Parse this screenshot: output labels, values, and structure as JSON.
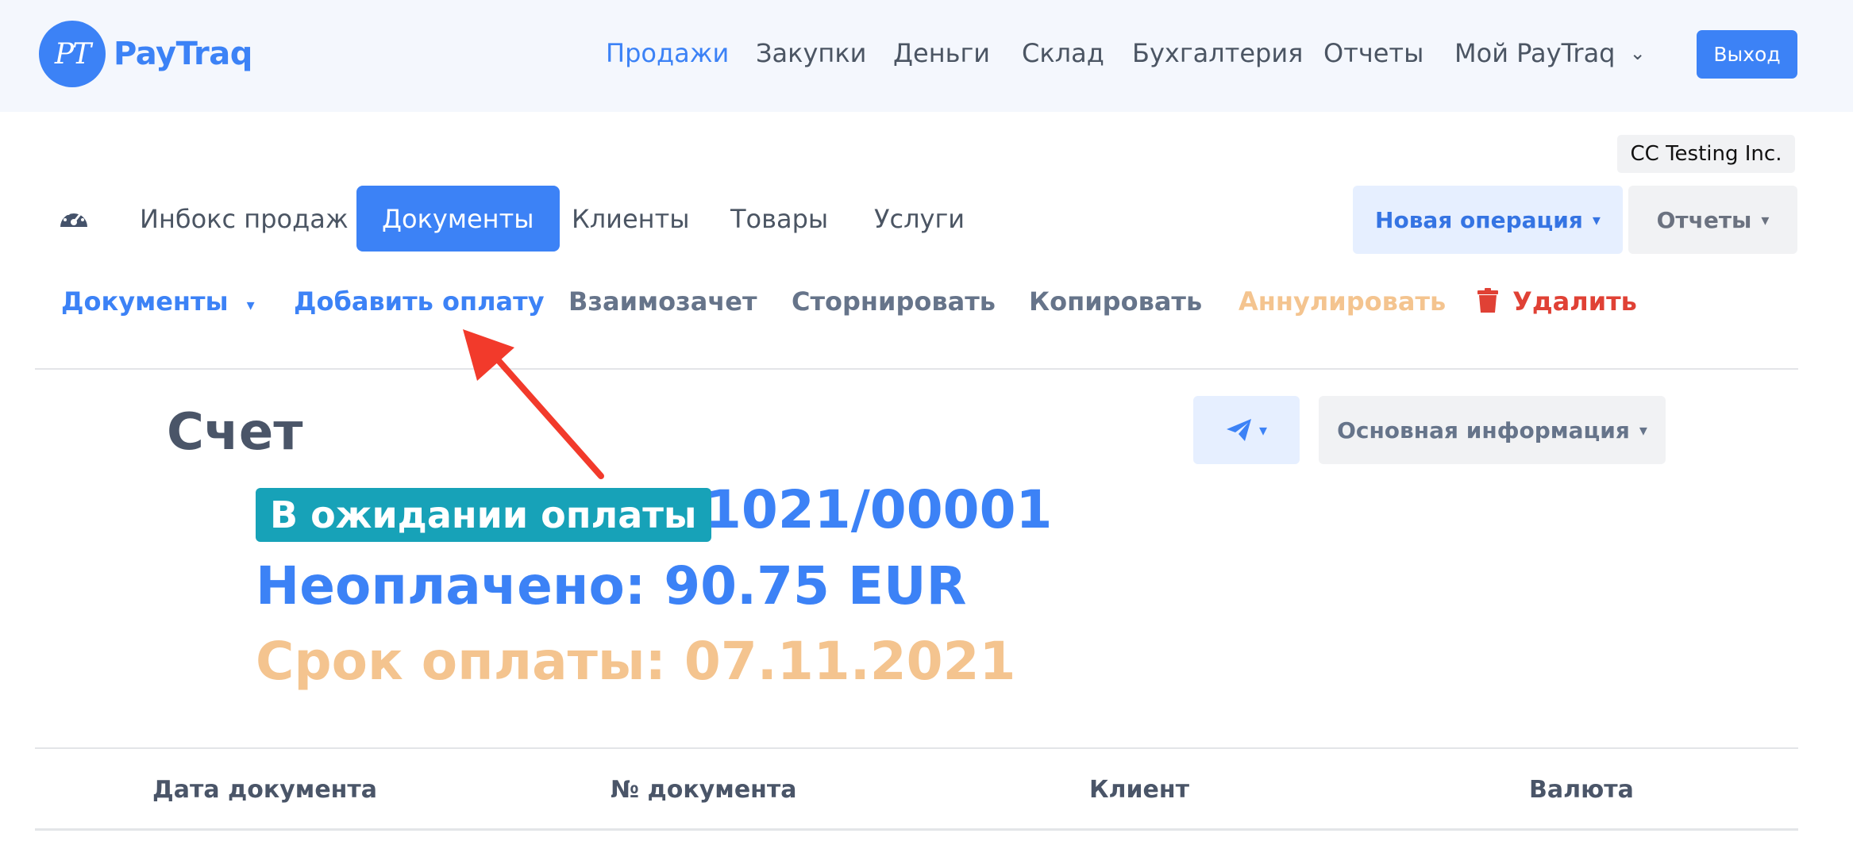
{
  "brand": {
    "logo_mark": "PT",
    "name": "PayTraq",
    "accent": "#3c82f6"
  },
  "topnav": {
    "items": [
      {
        "label": "Продажи",
        "active": true
      },
      {
        "label": "Закупки"
      },
      {
        "label": "Деньги"
      },
      {
        "label": "Склад"
      },
      {
        "label": "Бухгалтерия"
      },
      {
        "label": "Отчеты"
      },
      {
        "label": "Мой PayTraq",
        "has_dropdown": true
      }
    ],
    "logout_label": "Выход"
  },
  "company": "CC Testing Inc.",
  "section_tabs": {
    "dashboard_icon": "speedometer-icon",
    "items": [
      {
        "label": "Инбокс продаж"
      },
      {
        "label": "Документы",
        "active": true
      },
      {
        "label": "Клиенты"
      },
      {
        "label": "Товары"
      },
      {
        "label": "Услуги"
      }
    ],
    "new_operation_label": "Новая операция",
    "reports_label": "Отчеты"
  },
  "actions": {
    "documents_label": "Документы",
    "add_payment_label": "Добавить оплату",
    "offset_label": "Взаимозачет",
    "reverse_label": "Сторнировать",
    "copy_label": "Копировать",
    "cancel_label": "Аннулировать",
    "delete_label": "Удалить"
  },
  "document": {
    "type_title": "Счет",
    "status": "В ожидании оплаты",
    "status_color": "#17a2b8",
    "number": "1021/00001",
    "unpaid": "Неоплачено: 90.75 EUR",
    "due": "Срок оплаты: 07.11.2021",
    "send_icon": "paper-plane-icon",
    "info_label": "Основная информация"
  },
  "table": {
    "columns": [
      "Дата документа",
      "№ документа",
      "Клиент",
      "Валюта"
    ]
  },
  "annotation": {
    "arrow_color": "#f23a2b",
    "points_to": "add-payment-action"
  }
}
